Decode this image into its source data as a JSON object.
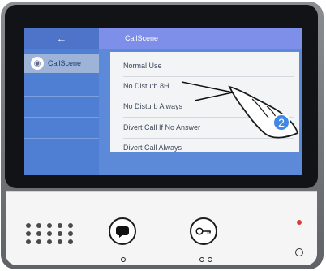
{
  "screen": {
    "title": "CallScene",
    "sidebar": {
      "back_icon": "arrow-left-icon",
      "back_symbol": "←",
      "selected_item": "CallScene",
      "selected_item_icon": "callscene-icon",
      "selected_item_icon_symbol": "◉"
    },
    "options": [
      "Normal Use",
      "No Disturb 8H",
      "No Disturb Always",
      "Divert Call If No Answer",
      "Divert Call Always"
    ],
    "step_badge": "2"
  },
  "colors": {
    "screen_blue": "#5c8ad8",
    "topbar_blue": "#7e8fea",
    "badge_blue": "#3f88e6"
  },
  "hardware_icons": {
    "talk": "talk-icon",
    "unlock": "key-icon"
  }
}
